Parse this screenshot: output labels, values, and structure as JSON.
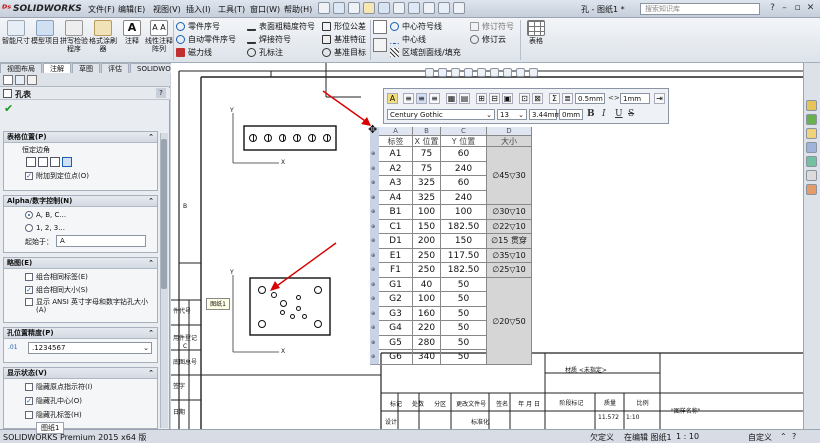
{
  "app": {
    "logo_text": "SOLIDWORKS",
    "doc_title": "孔 - 图纸1 *",
    "search_placeholder": "搜索知识库",
    "menus": [
      "文件(F)",
      "编辑(E)",
      "视图(V)",
      "插入(I)",
      "工具(T)",
      "窗口(W)",
      "帮助(H)"
    ]
  },
  "ribbon": {
    "big_buttons": [
      "智能尺寸",
      "模型项目",
      "拼写检验程序",
      "格式涂刷器",
      "注释",
      "线性注释阵列"
    ],
    "col1": [
      "零件序号",
      "自动零件序号",
      "磁力线"
    ],
    "col2": [
      "表面粗糙度符号",
      "焊接符号",
      "孔标注"
    ],
    "col3": [
      "形位公差",
      "基准特征",
      "基准目标"
    ],
    "col4": [
      "中心符号线",
      "中心线",
      "区域剖面线/填充"
    ],
    "col5": [
      "修订符号",
      "修订云"
    ],
    "table_btn": "表格"
  },
  "tabs": [
    "视图布局",
    "注解",
    "草图",
    "评估",
    "SOLIDWORKS 插件"
  ],
  "active_tab": "注解",
  "panel": {
    "title": "孔表",
    "help": "?",
    "table_position": {
      "header": "表格位置(P)",
      "corner_label": "恒定边角",
      "attach_label": "附加到定位点(O)",
      "attach_checked": true
    },
    "alpha": {
      "header": "Alpha/数字控制(N)",
      "opt1": "A, B, C...",
      "opt2": "1, 2, 3...",
      "start_label": "起始于：",
      "start_value": "A"
    },
    "tags": {
      "header": "略图(E)",
      "opt1": "组合相同标签(E)",
      "opt1_checked": false,
      "opt2": "组合相同大小(S)",
      "opt2_checked": true,
      "opt3": "显示 ANSI 英寸字母和数字钻孔大小(A)",
      "opt3_checked": false
    },
    "precision": {
      "header": "孔位置精度(P)",
      "value": ".1234567"
    },
    "visibility": {
      "header": "显示状态(V)",
      "opt1": "隐藏原点指示符(I)",
      "opt1_checked": false,
      "opt2": "隐藏孔中心(O)",
      "opt2_checked": true,
      "opt3": "隐藏孔标签(H)",
      "opt3_checked": false
    }
  },
  "format_toolbar": {
    "font": "Century Gothic",
    "size": "13",
    "height": "3.44mm",
    "margin": "0mm",
    "row_height": "0.5mm",
    "col_width": "1mm",
    "bold": "B",
    "italic": "I",
    "underline": "U",
    "strike": "S"
  },
  "hole_table": {
    "col_letters": [
      "A",
      "B",
      "C",
      "D"
    ],
    "headers": [
      "标签",
      "X 位置",
      "Y 位置",
      "大小"
    ],
    "rows": [
      {
        "tag": "A1",
        "x": "75",
        "y": "60"
      },
      {
        "tag": "A2",
        "x": "75",
        "y": "240"
      },
      {
        "tag": "A3",
        "x": "325",
        "y": "60"
      },
      {
        "tag": "A4",
        "x": "325",
        "y": "240"
      },
      {
        "tag": "B1",
        "x": "100",
        "y": "100"
      },
      {
        "tag": "C1",
        "x": "150",
        "y": "182.50"
      },
      {
        "tag": "D1",
        "x": "200",
        "y": "150"
      },
      {
        "tag": "E1",
        "x": "250",
        "y": "117.50"
      },
      {
        "tag": "F1",
        "x": "250",
        "y": "182.50"
      },
      {
        "tag": "G1",
        "x": "40",
        "y": "50"
      },
      {
        "tag": "G2",
        "x": "100",
        "y": "50"
      },
      {
        "tag": "G3",
        "x": "160",
        "y": "50"
      },
      {
        "tag": "G4",
        "x": "220",
        "y": "50"
      },
      {
        "tag": "G5",
        "x": "280",
        "y": "50"
      },
      {
        "tag": "G6",
        "x": "340",
        "y": "50"
      }
    ],
    "sizes": [
      "∅45▽30",
      "∅30▽10",
      "∅22▽10",
      "∅15 贯穿",
      "∅35▽10",
      "∅25▽10",
      "∅20▽50"
    ]
  },
  "drawing": {
    "view_tooltip": "图纸1",
    "frame_letters": [
      "B",
      "C"
    ],
    "left_labels": [
      "件代号",
      "用件登记",
      "底图总号",
      "签字",
      "日期"
    ],
    "title_block": {
      "material": "材质 <未指定>",
      "row_labels": [
        "标记",
        "处数",
        "分区",
        "更改文件号",
        "签名",
        "年 月 日"
      ],
      "stage_labels": [
        "阶段标记",
        "质量",
        "比例"
      ],
      "scale": "1:10",
      "weight": "11.572",
      "drawing_name": "\"图样名称\"",
      "design": "设计",
      "std": "标准化"
    },
    "origin_x": "X",
    "origin_y": "Y"
  },
  "status": {
    "left": "SOLIDWORKS Premium 2015 x64 版",
    "sheet_tab": "图纸1",
    "under": "欠定义",
    "editing": "在编辑 图纸1",
    "scale": "1 : 10",
    "custom": "自定义"
  },
  "colors": {
    "accent": "#1a5fb4",
    "table_header": "#dfe6f2",
    "row_header": "#c8d4e6",
    "selected_col": "#d6d6d6",
    "arrow": "#d90000"
  }
}
